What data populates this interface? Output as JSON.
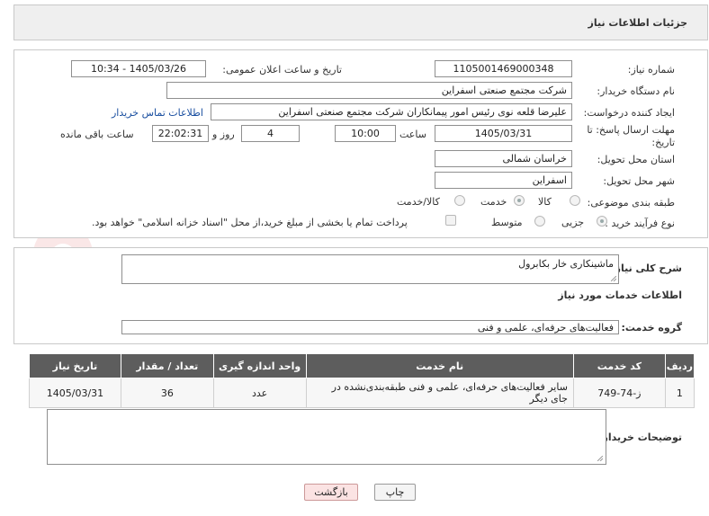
{
  "header": {
    "title": "جزئیات اطلاعات نیاز"
  },
  "form": {
    "need_number": {
      "label": "شماره نیاز:",
      "value": "1105001469000348"
    },
    "announce_datetime": {
      "label": "تاریخ و ساعت اعلان عمومی:",
      "value": "1405/03/26 - 10:34"
    },
    "buyer_org": {
      "label": "نام دستگاه خریدار:",
      "value": "شرکت مجتمع صنعتی اسفراین"
    },
    "requester": {
      "label": "ایجاد کننده درخواست:",
      "value": "علیرضا قلعه نوی رئیس امور پیمانکاران شرکت مجتمع صنعتی اسفراین",
      "contact_link": "اطلاعات تماس خریدار"
    },
    "deadline": {
      "label": "مهلت ارسال پاسخ: تا تاریخ:",
      "date": "1405/03/31",
      "time_label": "ساعت",
      "time": "10:00",
      "days": "4",
      "days_label": "روز و",
      "remaining": "22:02:31",
      "remaining_label": "ساعت باقی مانده"
    },
    "province": {
      "label": "استان محل تحویل:",
      "value": "خراسان شمالی"
    },
    "city": {
      "label": "شهر محل تحویل:",
      "value": "اسفراین"
    },
    "category": {
      "label": "طبقه بندی موضوعی:",
      "options": [
        "کالا",
        "خدمت",
        "کالا/خدمت"
      ],
      "selected": "خدمت"
    },
    "purchase_type": {
      "label": "نوع فرآیند خرید :",
      "options": [
        "جزیی",
        "متوسط"
      ],
      "selected": "جزیی",
      "payment_note": "پرداخت تمام یا بخشی از مبلغ خرید،از محل \"اسناد خزانه اسلامی\" خواهد بود."
    }
  },
  "summary": {
    "label": "شرح کلی نیاز:",
    "value": "ماشینکاری خار بکابرول"
  },
  "services_section": {
    "title": "اطلاعات خدمات مورد نیاز"
  },
  "service_group": {
    "label": "گروه خدمت:",
    "value": "فعالیت‌های حرفه‌ای، علمی و فنی"
  },
  "table": {
    "headers": [
      "ردیف",
      "کد خدمت",
      "نام خدمت",
      "واحد اندازه گیری",
      "تعداد / مقدار",
      "تاریخ نیاز"
    ],
    "rows": [
      [
        "1",
        "ز-74-749",
        "سایر فعالیت‌های حرفه‌ای، علمی و فنی طبقه‌بندی‌نشده در جای دیگر",
        "عدد",
        "36",
        "1405/03/31"
      ]
    ]
  },
  "buyer_notes": {
    "label": "توضیحات خریدار:",
    "value": ""
  },
  "buttons": {
    "print": "چاپ",
    "back": "بازگشت"
  },
  "watermark": "AriaTender.net"
}
